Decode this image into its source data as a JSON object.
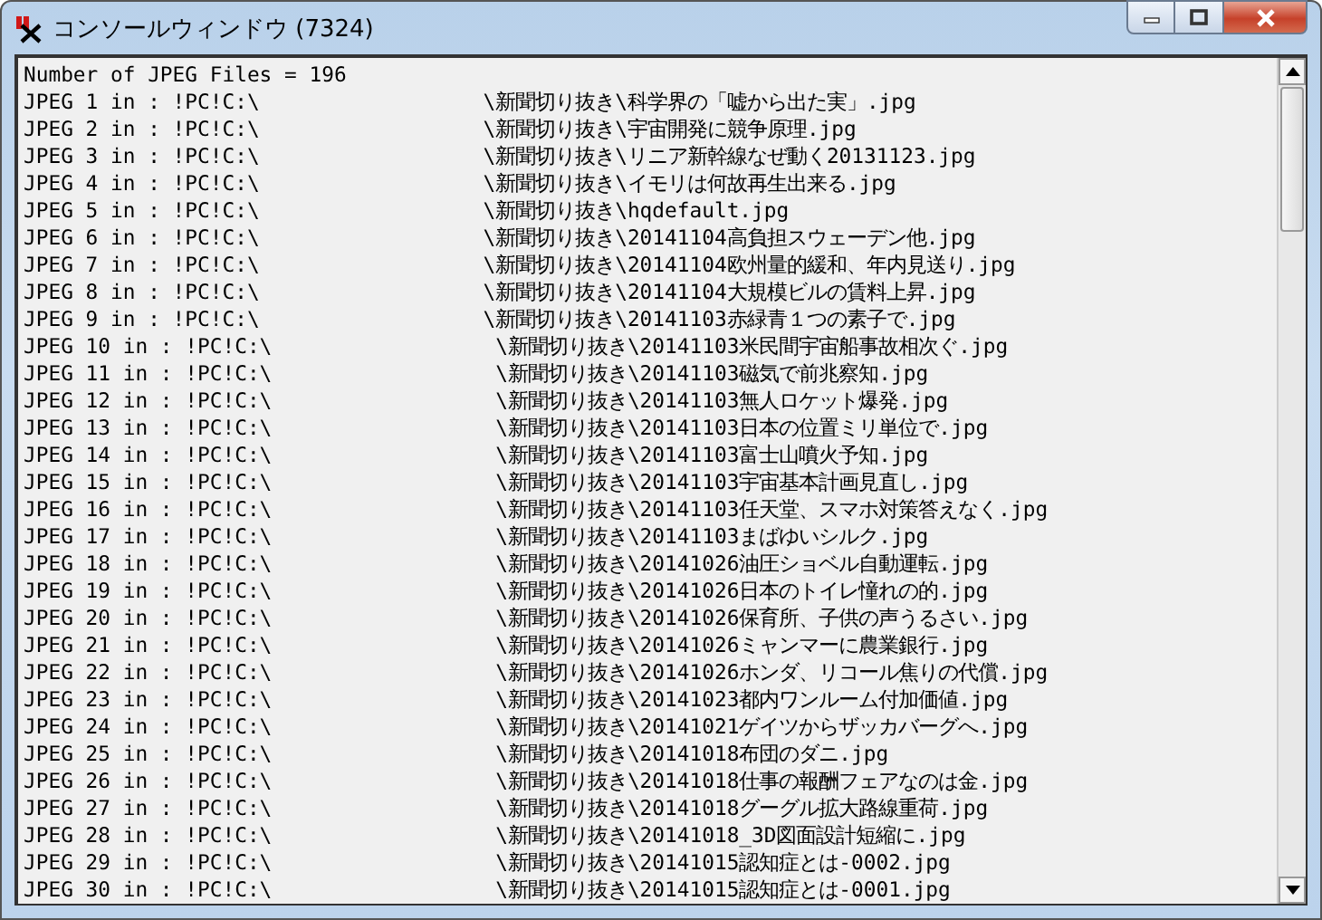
{
  "window": {
    "title": "コンソールウィンドウ (7324)"
  },
  "console": {
    "lines": [
      "Number of JPEG Files = 196",
      "JPEG 1 in : !PC!C:\\                  \\新聞切り抜き\\科学界の「嘘から出た実」.jpg",
      "JPEG 2 in : !PC!C:\\                  \\新聞切り抜き\\宇宙開発に競争原理.jpg",
      "JPEG 3 in : !PC!C:\\                  \\新聞切り抜き\\リニア新幹線なぜ動く20131123.jpg",
      "JPEG 4 in : !PC!C:\\                  \\新聞切り抜き\\イモリは何故再生出来る.jpg",
      "JPEG 5 in : !PC!C:\\                  \\新聞切り抜き\\hqdefault.jpg",
      "JPEG 6 in : !PC!C:\\                  \\新聞切り抜き\\20141104高負担スウェーデン他.jpg",
      "JPEG 7 in : !PC!C:\\                  \\新聞切り抜き\\20141104欧州量的緩和、年内見送り.jpg",
      "JPEG 8 in : !PC!C:\\                  \\新聞切り抜き\\20141104大規模ビルの賃料上昇.jpg",
      "JPEG 9 in : !PC!C:\\                  \\新聞切り抜き\\20141103赤緑青１つの素子で.jpg",
      "JPEG 10 in : !PC!C:\\                  \\新聞切り抜き\\20141103米民間宇宙船事故相次ぐ.jpg",
      "JPEG 11 in : !PC!C:\\                  \\新聞切り抜き\\20141103磁気で前兆察知.jpg",
      "JPEG 12 in : !PC!C:\\                  \\新聞切り抜き\\20141103無人ロケット爆発.jpg",
      "JPEG 13 in : !PC!C:\\                  \\新聞切り抜き\\20141103日本の位置ミリ単位で.jpg",
      "JPEG 14 in : !PC!C:\\                  \\新聞切り抜き\\20141103富士山噴火予知.jpg",
      "JPEG 15 in : !PC!C:\\                  \\新聞切り抜き\\20141103宇宙基本計画見直し.jpg",
      "JPEG 16 in : !PC!C:\\                  \\新聞切り抜き\\20141103任天堂、スマホ対策答えなく.jpg",
      "JPEG 17 in : !PC!C:\\                  \\新聞切り抜き\\20141103まばゆいシルク.jpg",
      "JPEG 18 in : !PC!C:\\                  \\新聞切り抜き\\20141026油圧ショベル自動運転.jpg",
      "JPEG 19 in : !PC!C:\\                  \\新聞切り抜き\\20141026日本のトイレ憧れの的.jpg",
      "JPEG 20 in : !PC!C:\\                  \\新聞切り抜き\\20141026保育所、子供の声うるさい.jpg",
      "JPEG 21 in : !PC!C:\\                  \\新聞切り抜き\\20141026ミャンマーに農業銀行.jpg",
      "JPEG 22 in : !PC!C:\\                  \\新聞切り抜き\\20141026ホンダ、リコール焦りの代償.jpg",
      "JPEG 23 in : !PC!C:\\                  \\新聞切り抜き\\20141023都内ワンルーム付加価値.jpg",
      "JPEG 24 in : !PC!C:\\                  \\新聞切り抜き\\20141021ゲイツからザッカバーグへ.jpg",
      "JPEG 25 in : !PC!C:\\                  \\新聞切り抜き\\20141018布団のダニ.jpg",
      "JPEG 26 in : !PC!C:\\                  \\新聞切り抜き\\20141018仕事の報酬フェアなのは金.jpg",
      "JPEG 27 in : !PC!C:\\                  \\新聞切り抜き\\20141018グーグル拡大路線重荷.jpg",
      "JPEG 28 in : !PC!C:\\                  \\新聞切り抜き\\20141018_3D図面設計短縮に.jpg",
      "JPEG 29 in : !PC!C:\\                  \\新聞切り抜き\\20141015認知症とは-0002.jpg",
      "JPEG 30 in : !PC!C:\\                  \\新聞切り抜き\\20141015認知症とは-0001.jpg"
    ]
  }
}
